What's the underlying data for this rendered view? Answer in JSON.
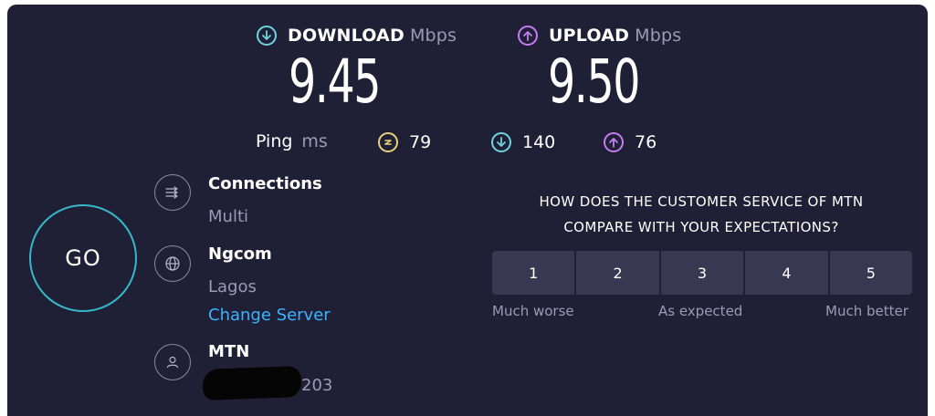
{
  "download": {
    "label": "DOWNLOAD",
    "unit": "Mbps",
    "value": "9.45",
    "icon": "download-arrow-icon",
    "color": "#6fd3e0"
  },
  "upload": {
    "label": "UPLOAD",
    "unit": "Mbps",
    "value": "9.50",
    "icon": "upload-arrow-icon",
    "color": "#c57cf0"
  },
  "ping": {
    "label": "Ping",
    "unit": "ms",
    "idle": "79",
    "download": "140",
    "upload": "76"
  },
  "go_label": "GO",
  "connections": {
    "title": "Connections",
    "value": "Multi",
    "icon": "connections-icon"
  },
  "server": {
    "title": "Ngcom",
    "location": "Lagos",
    "change_link": "Change Server",
    "icon": "globe-icon"
  },
  "provider": {
    "title": "MTN",
    "ip_suffix": "203",
    "icon": "user-icon"
  },
  "survey": {
    "question_line1": "HOW DOES THE CUSTOMER SERVICE OF MTN",
    "question_line2": "COMPARE WITH YOUR EXPECTATIONS?",
    "options": [
      "1",
      "2",
      "3",
      "4",
      "5"
    ],
    "label_low": "Much worse",
    "label_mid": "As expected",
    "label_high": "Much better"
  },
  "colors": {
    "background": "#1f1f36",
    "accent_go": "#36b8c8",
    "link": "#3db3ff",
    "ping_idle": "#e8d27a"
  }
}
